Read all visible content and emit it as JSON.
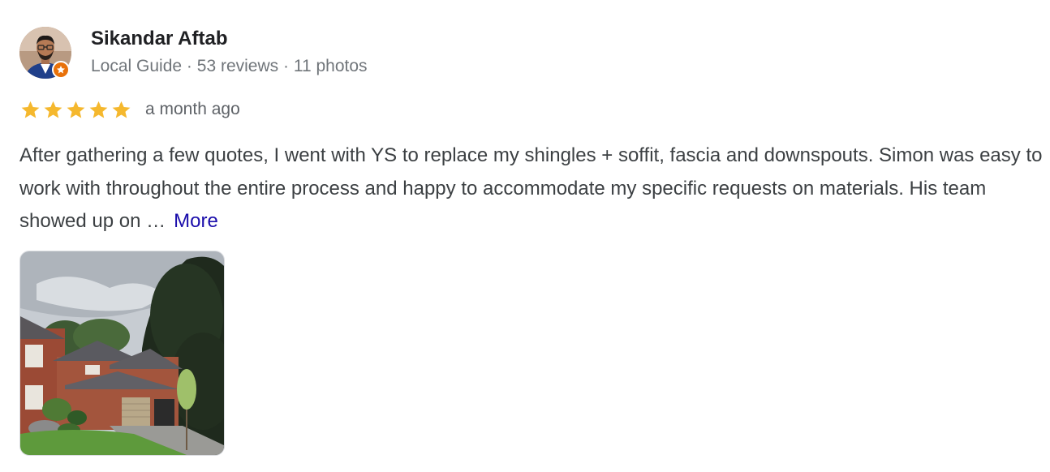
{
  "reviewer": {
    "name": "Sikandar Aftab",
    "role": "Local Guide",
    "reviews": "53 reviews",
    "photos": "11 photos",
    "separator": "·"
  },
  "rating": {
    "stars": 5,
    "max": 5,
    "star_color": "#f5b82e",
    "date": "a month ago"
  },
  "review": {
    "text": "After gathering a few quotes, I went with YS to replace my shingles + soffit, fascia and downspouts. Simon was easy to work with throughout the entire process and happy to accommodate my specific requests on materials. His team showed up on …",
    "more_label": "More"
  },
  "icons": {
    "avatar": "person-avatar",
    "badge": "local-guide-star-icon",
    "star": "star-icon",
    "photo": "house-photo"
  },
  "colors": {
    "badge": "#e8710a",
    "link": "#1a0dab",
    "meta": "#70757a"
  }
}
